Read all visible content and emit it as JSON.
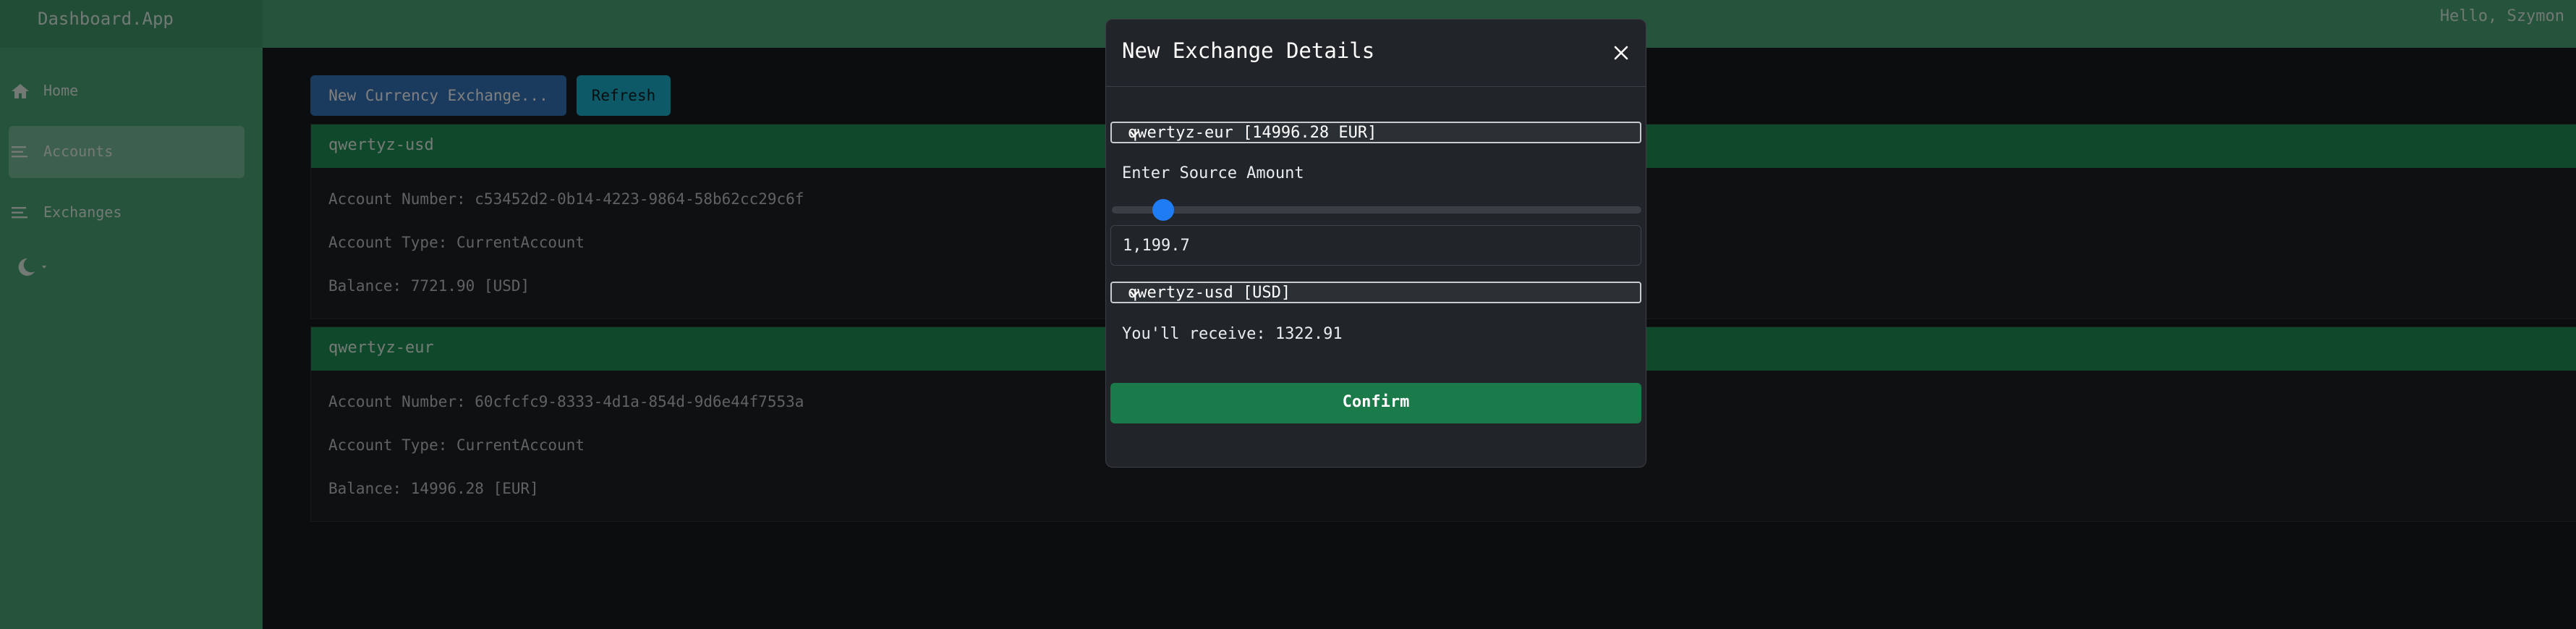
{
  "app": {
    "brand": "Dashboard.App",
    "greeting": "Hello, Szymon"
  },
  "sidebar": {
    "items": [
      {
        "label": "Home",
        "icon": "home-icon"
      },
      {
        "label": "Accounts",
        "icon": "list-icon",
        "active": true
      },
      {
        "label": "Exchanges",
        "icon": "list-icon"
      }
    ],
    "theme_icon": "moon-icon"
  },
  "toolbar": {
    "new_exchange_label": "New Currency Exchange...",
    "refresh_label": "Refresh"
  },
  "accounts": [
    {
      "name": "qwertyz-usd",
      "number_line": "Account Number: c53452d2-0b14-4223-9864-58b62cc29c6f",
      "type_line": "Account Type: CurrentAccount",
      "balance_line": "Balance: 7721.90 [USD]"
    },
    {
      "name": "qwertyz-eur",
      "number_line": "Account Number: 60cfcfc9-8333-4d1a-854d-9d6e44f7553a",
      "type_line": "Account Type: CurrentAccount",
      "balance_line": "Balance: 14996.28 [EUR]"
    }
  ],
  "modal": {
    "title": "New Exchange Details",
    "source_select": "qwertyz-eur [14996.28 EUR]",
    "amount_label": "Enter Source Amount",
    "slider_level": 0.08,
    "amount_value": "1,199.7",
    "target_select": "qwertyz-usd [USD]",
    "receive_text": "You'll receive: 1322.91",
    "confirm_label": "Confirm"
  },
  "colors": {
    "sidebar": "#4aa676",
    "card_header": "#1f9156",
    "primary": "#3577bd",
    "info": "#1bb3cf",
    "confirm": "#1b7a4a",
    "modal_bg": "#212529"
  }
}
